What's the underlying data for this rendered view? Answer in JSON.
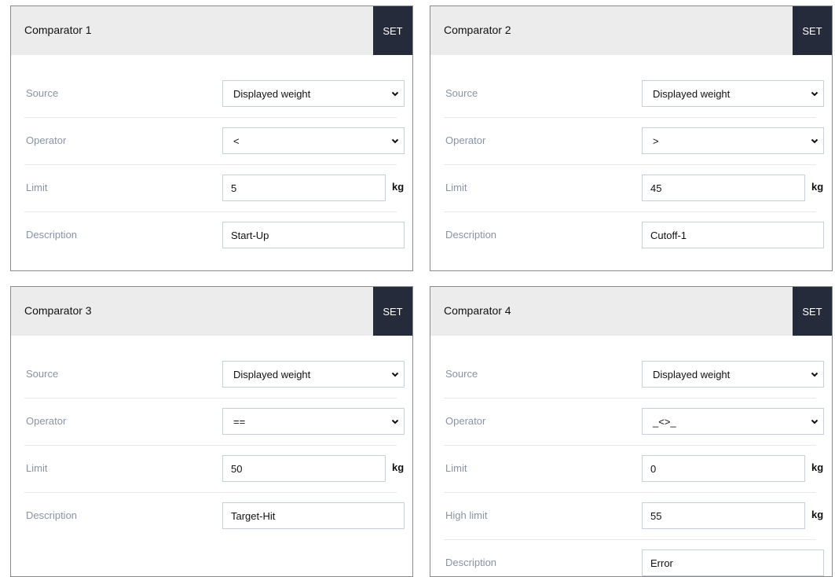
{
  "comparators": [
    {
      "title": "Comparator 1",
      "set_label": "SET",
      "source": {
        "label": "Source",
        "value": "Displayed weight"
      },
      "operator": {
        "label": "Operator",
        "value": "<"
      },
      "limit": {
        "label": "Limit",
        "value": "5",
        "unit": "kg"
      },
      "description": {
        "label": "Description",
        "value": "Start-Up"
      }
    },
    {
      "title": "Comparator 2",
      "set_label": "SET",
      "source": {
        "label": "Source",
        "value": "Displayed weight"
      },
      "operator": {
        "label": "Operator",
        "value": ">"
      },
      "limit": {
        "label": "Limit",
        "value": "45",
        "unit": "kg"
      },
      "description": {
        "label": "Description",
        "value": "Cutoff-1"
      }
    },
    {
      "title": "Comparator 3",
      "set_label": "SET",
      "source": {
        "label": "Source",
        "value": "Displayed weight"
      },
      "operator": {
        "label": "Operator",
        "value": "=="
      },
      "limit": {
        "label": "Limit",
        "value": "50",
        "unit": "kg"
      },
      "description": {
        "label": "Description",
        "value": "Target-Hit"
      }
    },
    {
      "title": "Comparator 4",
      "set_label": "SET",
      "source": {
        "label": "Source",
        "value": "Displayed weight"
      },
      "operator": {
        "label": "Operator",
        "value": "_<>_"
      },
      "limit": {
        "label": "Limit",
        "value": "0",
        "unit": "kg"
      },
      "high_limit": {
        "label": "High limit",
        "value": "55",
        "unit": "kg"
      },
      "description": {
        "label": "Description",
        "value": "Error"
      }
    }
  ],
  "icons": {
    "dropdown": "chevron-down-icon"
  }
}
